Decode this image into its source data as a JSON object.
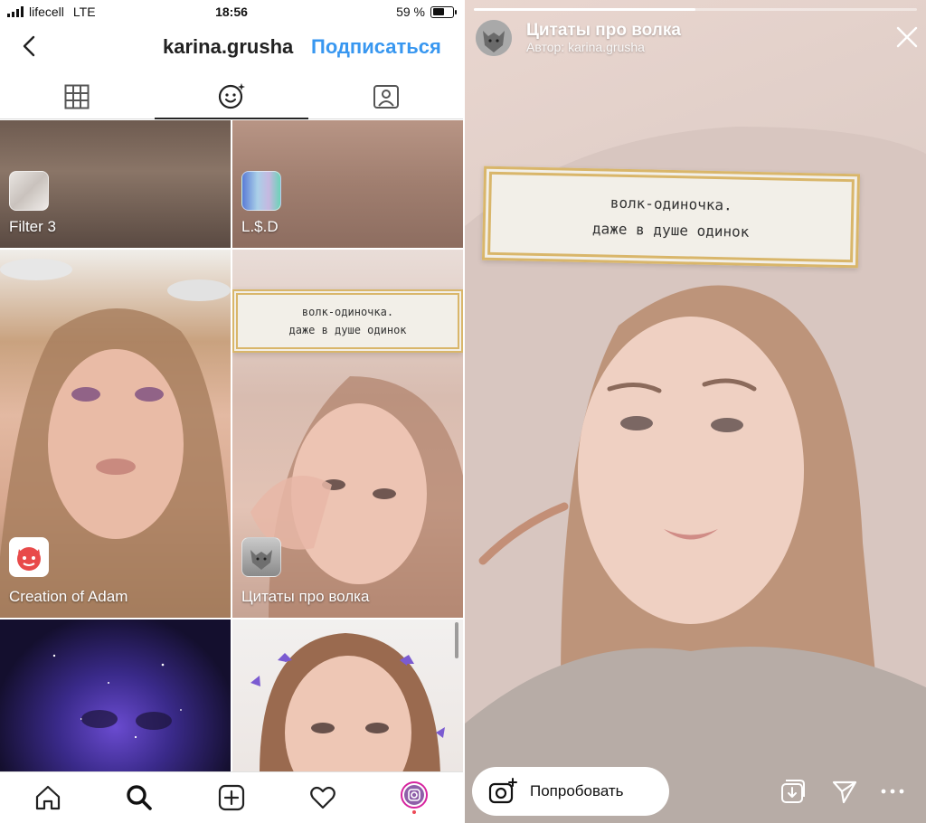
{
  "status_bar": {
    "carrier": "lifecell",
    "network": "LTE",
    "time": "18:56",
    "battery_text": "59 %",
    "battery_level": 0.59
  },
  "profile_header": {
    "username": "karina.grusha",
    "follow_label": "Подписаться"
  },
  "tabs": [
    {
      "name": "grid-icon",
      "active": false
    },
    {
      "name": "effects-icon",
      "active": true
    },
    {
      "name": "tagged-icon",
      "active": false
    }
  ],
  "effects": [
    {
      "label": "Filter 3",
      "thumb_icon": "marble-icon"
    },
    {
      "label": "L.$.D",
      "thumb_icon": "glitch-icon"
    },
    {
      "label": "Creation of Adam",
      "thumb_icon": "devil-emoji-icon"
    },
    {
      "label": "Цитаты про волка",
      "thumb_icon": "wolf-icon"
    },
    {
      "label": "",
      "thumb_icon": ""
    },
    {
      "label": "",
      "thumb_icon": ""
    }
  ],
  "quote_sign": {
    "line1": "волк-одиночка.",
    "line2": "даже в душе одинок"
  },
  "bottom_nav": [
    "home-icon",
    "search-icon",
    "add-post-icon",
    "activity-heart-icon",
    "profile-avatar-icon"
  ],
  "story": {
    "progress": 0.5,
    "title": "Цитаты про волка",
    "author": "Автор: karina.grusha",
    "try_label": "Попробовать",
    "actions": [
      "save-effect-icon",
      "share-icon",
      "more-icon"
    ]
  },
  "colors": {
    "accent": "#3897f0",
    "text": "#262626"
  }
}
